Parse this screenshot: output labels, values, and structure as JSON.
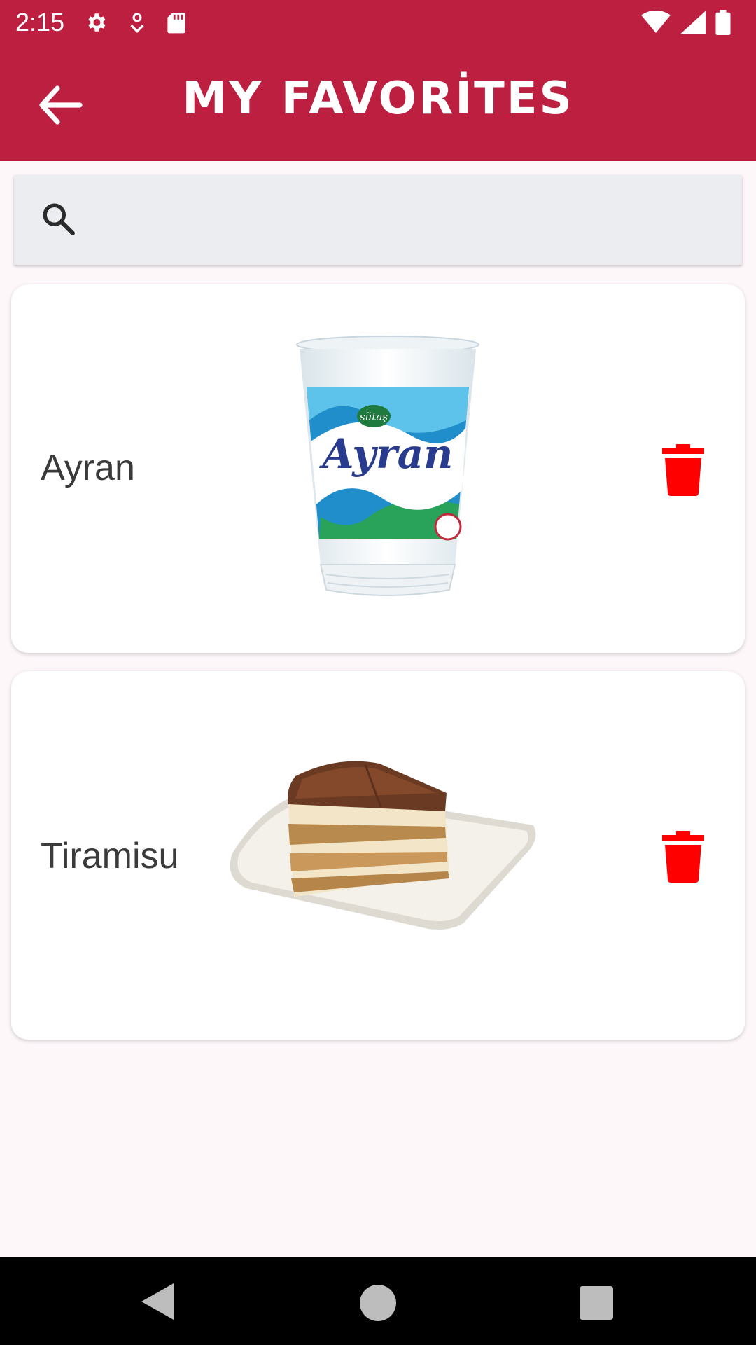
{
  "status_bar": {
    "time": "2:15",
    "icons": [
      "settings-icon",
      "location-icon",
      "sd-card-icon",
      "wifi-icon",
      "signal-icon",
      "battery-icon"
    ]
  },
  "app_bar": {
    "title": "MY FAVORİTES",
    "back_icon": "arrow-back-icon",
    "background_color": "#bd1f40"
  },
  "search": {
    "icon": "search-icon",
    "value": "",
    "placeholder": ""
  },
  "favorites": [
    {
      "name": "Ayran",
      "image": "ayran-cup-image",
      "delete_icon": "trash-icon"
    },
    {
      "name": "Tiramisu",
      "image": "tiramisu-cake-image",
      "delete_icon": "trash-icon"
    }
  ],
  "colors": {
    "accent": "#bd1f40",
    "delete": "#ff0000",
    "page_background": "#fdf7fa",
    "search_background": "#ebedf0"
  },
  "nav_bar": {
    "buttons": [
      "back-triangle-icon",
      "home-circle-icon",
      "recents-square-icon"
    ]
  }
}
